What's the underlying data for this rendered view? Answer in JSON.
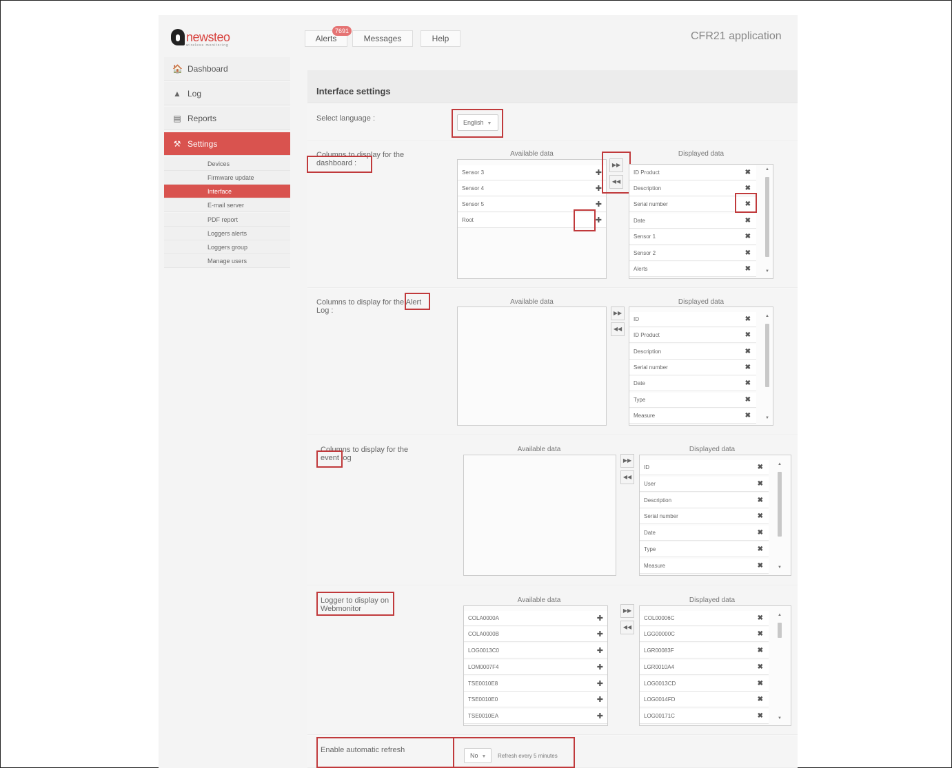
{
  "brand": {
    "name": "newsteo",
    "tagline": "wireless monitoring"
  },
  "header": {
    "nav": [
      {
        "label": "Alerts"
      },
      {
        "label": "Messages"
      },
      {
        "label": "Help"
      }
    ],
    "alerts_badge": "7691",
    "app_title": "CFR21 application"
  },
  "sidebar": {
    "items": [
      {
        "label": "Dashboard",
        "icon": "home-icon"
      },
      {
        "label": "Log",
        "icon": "tree-icon"
      },
      {
        "label": "Reports",
        "icon": "calendar-icon"
      },
      {
        "label": "Settings",
        "icon": "wrench-icon"
      }
    ],
    "subitems": [
      "Devices",
      "Firmware update",
      "Interface",
      "E-mail server",
      "PDF report",
      "Loggers alerts",
      "Loggers group",
      "Manage users"
    ],
    "active_item": "Settings",
    "active_subitem": "Interface"
  },
  "page": {
    "title": "Interface settings",
    "language": {
      "label": "Select language :",
      "value": "English"
    },
    "available_header": "Available data",
    "displayed_header": "Displayed data",
    "dashboard_section": {
      "label": "Columns to display for the dashboard :",
      "available": [
        "Sensor 3",
        "Sensor 4",
        "Sensor 5",
        "Root"
      ],
      "displayed": [
        "ID Product",
        "Description",
        "Serial number",
        "Date",
        "Sensor 1",
        "Sensor 2",
        "Alerts"
      ]
    },
    "alert_section": {
      "label": "Columns to display for the Alert Log :",
      "available": [],
      "displayed": [
        "ID",
        "ID Product",
        "Description",
        "Serial number",
        "Date",
        "Type",
        "Measure"
      ]
    },
    "event_section": {
      "label": "Columns to display for the event log",
      "available": [],
      "displayed": [
        "ID",
        "User",
        "Description",
        "Serial number",
        "Date",
        "Type",
        "Measure"
      ]
    },
    "logger_section": {
      "label": "Logger to display on Webmonitor",
      "available": [
        "COLA0000A",
        "COLA0000B",
        "LOG0013C0",
        "LOM0007F4",
        "TSE0010E8",
        "TSE0010E0",
        "TSE0010EA"
      ],
      "displayed": [
        "COL00006C",
        "LGG00000C",
        "LGR00083F",
        "LGR0010A4",
        "LOG0013CD",
        "LOG0014FD",
        "LOG00171C"
      ]
    },
    "refresh": {
      "label": "Enable automatic refresh",
      "value": "No",
      "note": "Refresh every 5 minutes"
    }
  },
  "icons": {
    "add": "plus-icon",
    "remove": "remove-icon",
    "move_right": "double-right-icon",
    "move_left": "double-left-icon"
  },
  "colors": {
    "accent": "#d9534f",
    "highlight": "#c0393b"
  }
}
